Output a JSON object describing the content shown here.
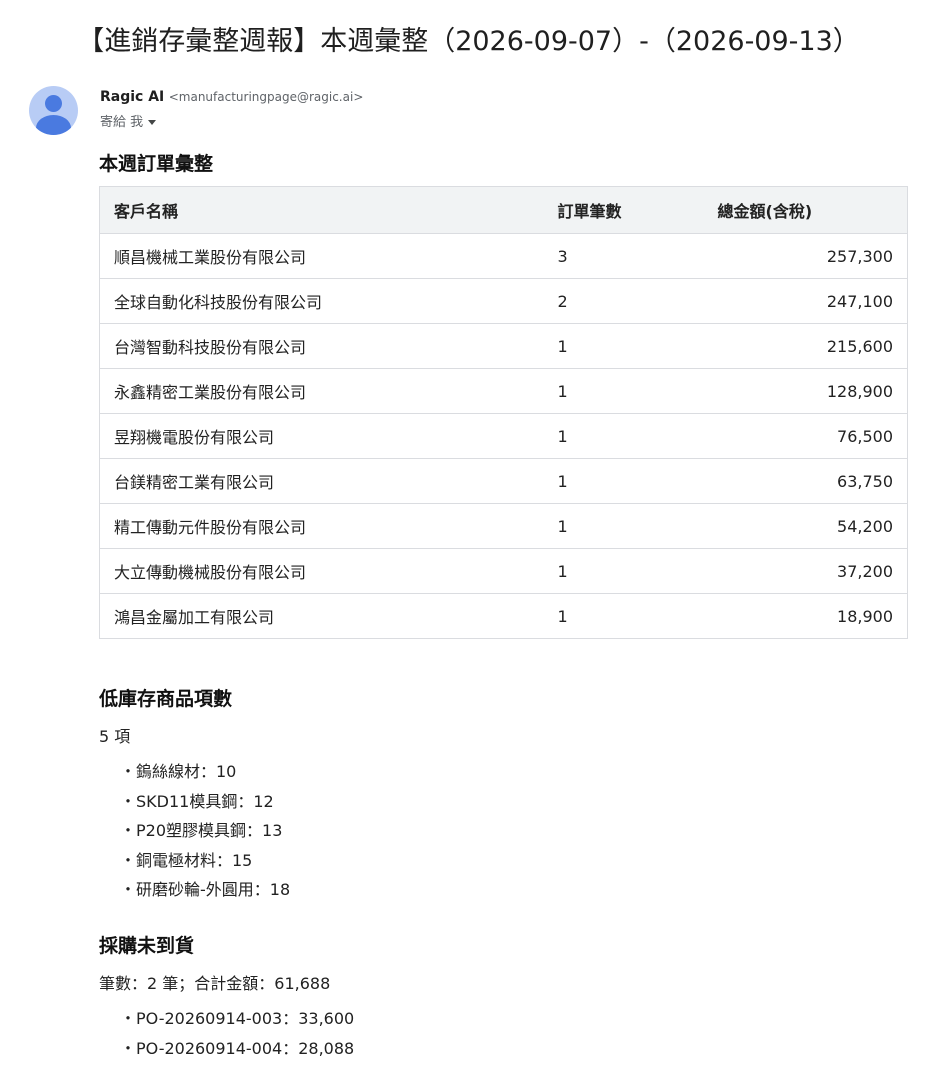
{
  "email": {
    "subject": "【進銷存彙整週報】本週彙整（2026-09-07）-（2026-09-13）",
    "sender_name": "Ragic AI",
    "sender_email": "<manufacturingpage@ragic.ai>",
    "recipient": "寄給 我"
  },
  "orders": {
    "title": "本週訂單彙整",
    "headers": [
      "客戶名稱",
      "訂單筆數",
      "總金額(含稅)"
    ],
    "rows": [
      {
        "customer": "順昌機械工業股份有限公司",
        "count": "3",
        "amount": "257,300"
      },
      {
        "customer": "全球自動化科技股份有限公司",
        "count": "2",
        "amount": "247,100"
      },
      {
        "customer": "台灣智動科技股份有限公司",
        "count": "1",
        "amount": "215,600"
      },
      {
        "customer": "永鑫精密工業股份有限公司",
        "count": "1",
        "amount": "128,900"
      },
      {
        "customer": "昱翔機電股份有限公司",
        "count": "1",
        "amount": "76,500"
      },
      {
        "customer": "台鎂精密工業有限公司",
        "count": "1",
        "amount": "63,750"
      },
      {
        "customer": "精工傳動元件股份有限公司",
        "count": "1",
        "amount": "54,200"
      },
      {
        "customer": "大立傳動機械股份有限公司",
        "count": "1",
        "amount": "37,200"
      },
      {
        "customer": "鴻昌金屬加工有限公司",
        "count": "1",
        "amount": "18,900"
      }
    ]
  },
  "low_stock": {
    "title": "低庫存商品項數",
    "summary": "5 項",
    "items": [
      "鎢絲線材：10",
      "SKD11模具鋼：12",
      "P20塑膠模具鋼：13",
      "銅電極材料：15",
      "研磨砂輪-外圓用：18"
    ]
  },
  "pending_purchase": {
    "title": "採購未到貨",
    "summary": "筆數：2 筆；合計金額：61,688",
    "items": [
      "PO-20260914-003：33,600",
      "PO-20260914-004：28,088"
    ]
  }
}
